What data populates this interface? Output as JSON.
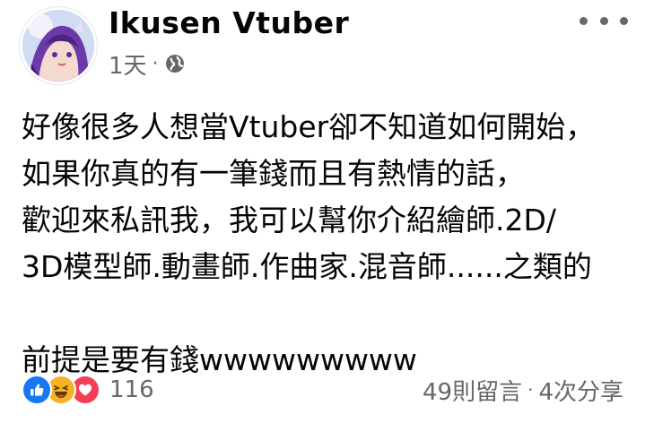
{
  "post": {
    "author": "Ikusen Vtuber",
    "time": "1天",
    "separator": "·",
    "privacy_icon": "globe-icon",
    "more_icon": "more-options-icon",
    "lines": [
      "好像很多人想當Vtuber卻不知道如何開始，",
      "如果你真的有一筆錢而且有熱情的話，",
      "歡迎來私訊我，我可以幫你介紹繪師.2D/",
      "3D模型師.動畫師.作曲家.混音師......之類的",
      "",
      "前提是要有錢wwwwwwwww"
    ]
  },
  "footer": {
    "reaction_icons": [
      "like-icon",
      "haha-icon",
      "love-icon"
    ],
    "reaction_count": "116",
    "comments": "49則留言",
    "separator": "·",
    "shares": "4次分享"
  },
  "colors": {
    "like": "#1877f2",
    "haha": "#f7b125",
    "love": "#f33e58",
    "secondary_text": "#65676b"
  }
}
